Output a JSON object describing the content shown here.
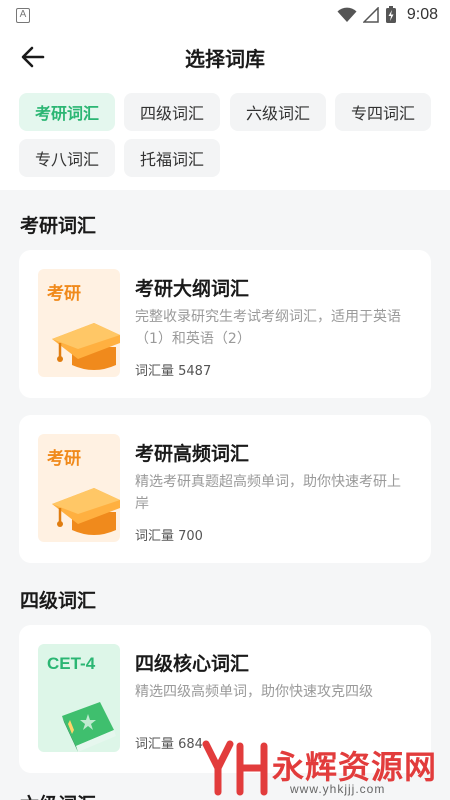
{
  "status_bar": {
    "app_icon_letter": "A",
    "time": "9:08",
    "icons": [
      "wifi-icon",
      "signal-icon",
      "battery-charging-icon"
    ]
  },
  "header": {
    "title": "选择词库",
    "back_icon": "arrow-left-icon"
  },
  "tags": [
    {
      "label": "考研词汇",
      "active": true
    },
    {
      "label": "四级词汇",
      "active": false
    },
    {
      "label": "六级词汇",
      "active": false
    },
    {
      "label": "专四词汇",
      "active": false
    },
    {
      "label": "专八词汇",
      "active": false
    },
    {
      "label": "托福词汇",
      "active": false
    }
  ],
  "sections": [
    {
      "title": "考研词汇",
      "books": [
        {
          "cover_label": "考研",
          "cover_icon": "graduation-cap-icon",
          "title": "考研大纲词汇",
          "description": "完整收录研究生考试考纲词汇，适用于英语（1）和英语（2）",
          "count": "词汇量 5487"
        },
        {
          "cover_label": "考研",
          "cover_icon": "graduation-cap-icon",
          "title": "考研高频词汇",
          "description": "精选考研真题超高频单词，助你快速考研上岸",
          "count": "词汇量 700"
        }
      ]
    },
    {
      "title": "四级词汇",
      "books": [
        {
          "cover_label": "CET-4",
          "cover_icon": "book-star-icon",
          "title": "四级核心词汇",
          "description": "精选四级高频单词，助你快速攻克四级",
          "count": "词汇量 684"
        }
      ]
    },
    {
      "title": "六级词汇"
    }
  ],
  "watermark": {
    "text": "永辉资源网",
    "url": "www.yhkjjj.com",
    "color": "#e23c3c"
  },
  "colors": {
    "accent": "#2bb673",
    "cover_orange": "#f08a1c"
  }
}
